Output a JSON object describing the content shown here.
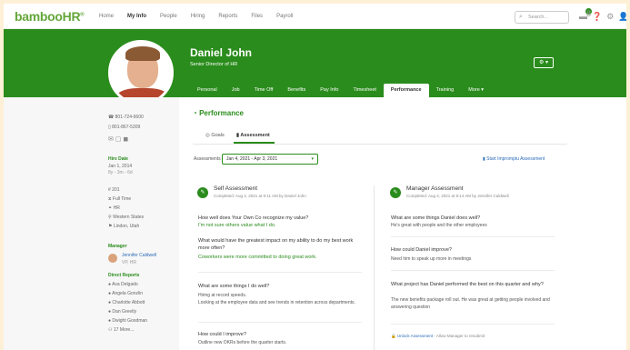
{
  "nav": {
    "logo": "bambooHR",
    "links": [
      "Home",
      "My Info",
      "People",
      "Hiring",
      "Reports",
      "Files",
      "Payroll"
    ],
    "search_placeholder": "Search...",
    "notification_count": "8"
  },
  "employee": {
    "name": "Daniel John",
    "title": "Senior Director of HR"
  },
  "tabs": [
    "Personal",
    "Job",
    "Time Off",
    "Benefits",
    "Pay Info",
    "Timesheet",
    "Performance",
    "Training",
    "More ▾"
  ],
  "sidebar": {
    "phone_work": "801-724-6600",
    "phone_mobile": "801-867-5309",
    "hire_date_label": "Hire Date",
    "hire_date": "Jan 1, 2014",
    "tenure": "8y - 3m - 6d",
    "emp_num": "201",
    "status": "Full Time",
    "department": "HR",
    "division": "Western States",
    "location": "Lindon, Utah",
    "manager_label": "Manager",
    "manager_name": "Jennifer Caldwell",
    "manager_title": "VP, HR",
    "reports_label": "Direct Reports",
    "reports": [
      "Ava Delgado",
      "Angela Gonzlin",
      "Charlotte Abbott",
      "Dan Greetly",
      "Dwight Goodman"
    ],
    "more": "17 More..."
  },
  "page": {
    "title": "Performance",
    "subtab_goals": "Goals",
    "subtab_assessment": "Assessment",
    "assessment_label": "Assessments",
    "assessment_period": "Jan 4, 2021 - Apr 3, 2021",
    "impromptu": "Start Impromptu Assessment"
  },
  "self": {
    "title": "Self Assessment",
    "completed": "Completed: Aug 4, 2021 at 9:11 AM by Daniel John",
    "q1": "How well does Your Own Co recognize my value?",
    "a1": "I'm not sure others value what I do.",
    "q2": "What would have the greatest impact on my ability to do my best work more often?",
    "a2": "Coworkers were more committed to doing great work.",
    "q3": "What are some things I do well?",
    "a3": "Hiring at record speeds.\nLooking at the employee data and see trends in retention across departments.",
    "q4": "How could I improve?",
    "a4": "Outline new OKRs before the quarter starts."
  },
  "manager": {
    "title": "Manager Assessment",
    "completed": "Completed: Aug 4, 2021 at 9:14 AM by Jennifer Caldwell",
    "q1": "What are some things Daniel does well?",
    "a1": "He's great with people and the other employees",
    "q2": "How could Daniel improve?",
    "a2": "Need him to speak up more in meetings",
    "q3": "What project has Daniel performed the best on this quarter and why?",
    "a3": "The new benefits package roll out. He was great at getting people involved and answering question",
    "unlock_link": "Unlock Assessment",
    "unlock_rest": "- Allow Manager to resubmit"
  }
}
